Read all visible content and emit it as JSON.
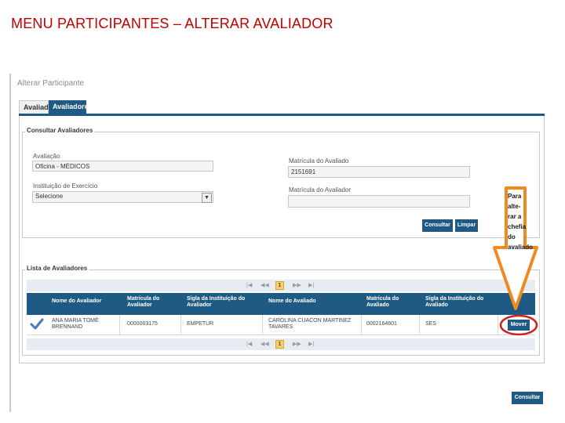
{
  "slide": {
    "title": "MENU PARTICIPANTES – ALTERAR  AVALIADOR"
  },
  "window": {
    "title": "Alterar Participante"
  },
  "tabs": [
    {
      "label": "Avaliados"
    },
    {
      "label": "Avaliadores"
    }
  ],
  "consultar": {
    "legend": "Consultar Avaliadores",
    "avaliacao_label": "Avaliação",
    "avaliacao_value": "Oficina - MÉDICOS",
    "instituicao_label": "Instituição de Exercício",
    "instituicao_value": "Selecione",
    "matricula_avaliado_label": "Matrícula do Avaliado",
    "matricula_avaliado_value": "2151691",
    "matricula_avaliador_label": "Matrícula do Avaliador",
    "matricula_avaliador_value": "",
    "consultar_button": "Consultar",
    "limpar_button": "Limpar"
  },
  "lista": {
    "legend": "Lista de Avaliadores",
    "page": "1",
    "headers": [
      "Nome do Avaliador",
      "Matrícula do Avaliador",
      "Sigla da Instituição do Avaliador",
      "Nome do Avaliado",
      "Matrícula do Avaliado",
      "Sigla da Instituição do Avaliado"
    ],
    "row": {
      "nome_avaliador": "ANA MARIA TOMÉ BRENNAND",
      "matricula_avaliador": "0000003175",
      "sigla_avaliador": "EMPETUR",
      "nome_avaliado": "CAROLINA CUACON MARTINEZ TAVARES",
      "matricula_avaliado": "0002164601",
      "sigla_avaliado": "SES",
      "mover_button": "Mover"
    }
  },
  "bottom_button": "Consultar",
  "callout": {
    "lines": [
      "Para",
      "alte-",
      "rar a",
      "chefia",
      "do",
      "avaliado"
    ],
    "arrow_color": "#ef8a1e",
    "circle_color": "#d02020"
  },
  "colors": {
    "accent": "#1e5a84",
    "title_red": "#c00000"
  }
}
